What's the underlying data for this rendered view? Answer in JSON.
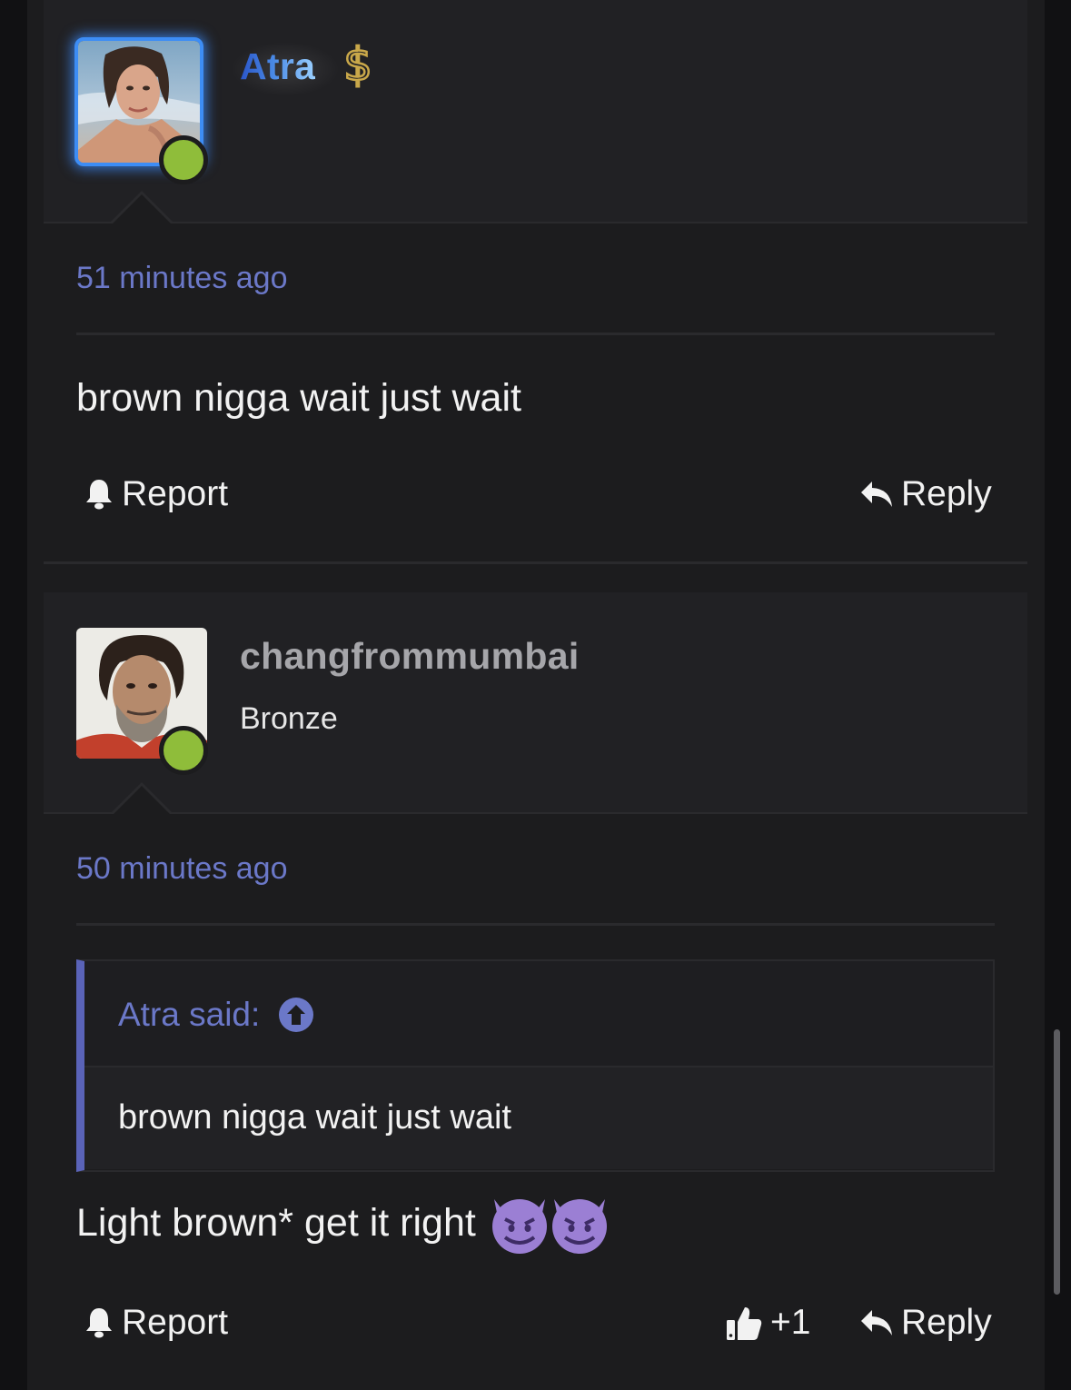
{
  "posts": [
    {
      "username": "Atra",
      "user_badge_icon": "dollar-icon",
      "user_title": "",
      "timestamp": "51 minutes ago",
      "message": "brown nigga wait just wait",
      "actions": {
        "report": "Report",
        "reply": "Reply"
      }
    },
    {
      "username": "changfrommumbai",
      "user_title": "Bronze",
      "timestamp": "50 minutes ago",
      "quote": {
        "attribution": "Atra said:",
        "text": "brown nigga wait just wait"
      },
      "message": "Light brown* get it right",
      "message_emoji": "😈😈",
      "actions": {
        "report": "Report",
        "like_count": "+1",
        "reply": "Reply"
      }
    }
  ],
  "colors": {
    "accent": "#6b78c8",
    "online": "#8fbd3a",
    "avatar_glow": "#3d8df5"
  }
}
